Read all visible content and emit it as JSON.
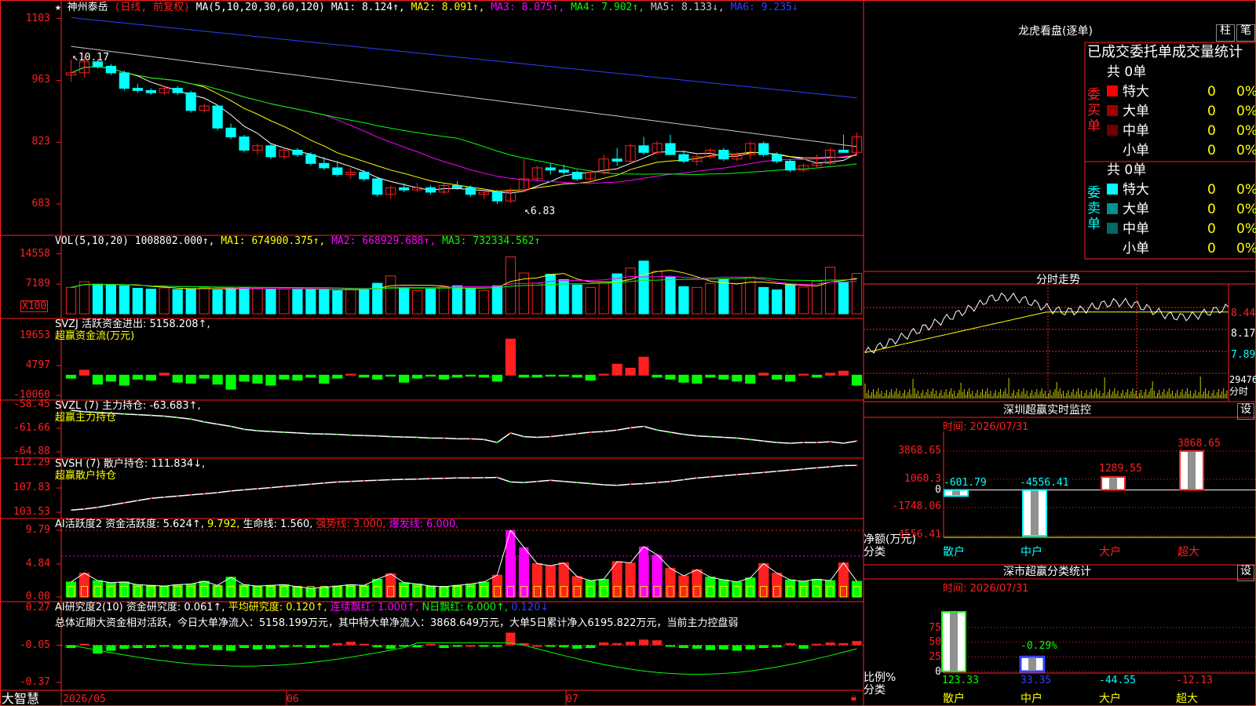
{
  "colors": {
    "up": "#ff2020",
    "down": "#00ffff",
    "bg": "#000000",
    "axis": "#ff2020",
    "yellow": "#ffff00",
    "white": "#ffffff",
    "magenta": "#ff00ff",
    "green": "#00ff00",
    "blue": "#3040ff",
    "orange": "#ff8000"
  },
  "stock": {
    "star": "★",
    "name": "神州泰岳",
    "mode": "(日线, 前复权)",
    "ma_label": "MA(5,10,20,30,60,120)",
    "ma": [
      {
        "label": "MA1: 8.124↑,",
        "color": "#ffffff"
      },
      {
        "label": "MA2: 8.091↑,",
        "color": "#ffff00"
      },
      {
        "label": "MA3: 8.075↑,",
        "color": "#ff00ff"
      },
      {
        "label": "MA4: 7.902↑,",
        "color": "#00ff00"
      },
      {
        "label": "MA5: 8.133↓,",
        "color": "#c8c8c8"
      },
      {
        "label": "MA6: 9.235↓",
        "color": "#3040ff"
      }
    ]
  },
  "price_axis": [
    "1103",
    "963",
    "823",
    "683"
  ],
  "price_high_label": "10.17",
  "price_low_label": "6.83",
  "vol": {
    "prefix": "VOL(5,10,20)",
    "value": "1008802.000↑,",
    "items": [
      {
        "label": "MA1: 674900.375↑,",
        "color": "#ffff00"
      },
      {
        "label": "MA2: 668929.688↑,",
        "color": "#ff00ff"
      },
      {
        "label": "MA3: 732334.562↑",
        "color": "#00ff00"
      }
    ],
    "axis": [
      "14558",
      "7189"
    ],
    "unit": "X100"
  },
  "svzj": {
    "title": "SVZJ  活跃资金进出: 5158.208↑,",
    "subtitle": "超赢资金流(万元)",
    "axis": [
      "19653",
      "4797",
      "-10060"
    ]
  },
  "svzl": {
    "title": "SVZL (7) 主力持仓: -63.683↑,",
    "subtitle": "超赢主力持仓",
    "axis": [
      "-58.45",
      "-61.66",
      "-64.88"
    ]
  },
  "svsh": {
    "title": "SVSH (7) 散户持仓: 111.834↓,",
    "subtitle": "超赢散户持仓",
    "axis": [
      "112.29",
      "107.83",
      "103.53"
    ]
  },
  "ai_act": {
    "title": "AI活跃度2 资金活跃度: 5.624↑,",
    "v2": "9.792,",
    "v3": "生命线: 1.560,",
    "v4": "强势线: 3.000,",
    "v5": "爆发线: 6.000,",
    "axis": [
      "9.79",
      "4.84",
      "0.00"
    ]
  },
  "ai_res": {
    "p1": "AI研究度2(10) 资金研究度: 0.061↑,",
    "p2": "平均研究度: 0.120↑,",
    "p3": "连续飘红: 1.000↑,",
    "p4": "N日飘红: 6.000↑,",
    "p5": "0.120↓",
    "desc": "总体近期大资金相对活跃，今日大单净流入：5158.199万元，其中特大单净流入：3868.649万元，大单5日累计净入6195.822万元，当前主力控盘弱",
    "axis": [
      "0.27",
      "-0.05",
      "-0.37"
    ]
  },
  "dates": [
    "2026/05",
    "06",
    "07"
  ],
  "brand": "大智慧",
  "panel": {
    "title": "龙虎看盘(逐单)",
    "tab1": "柱",
    "tab2": "笔",
    "headers": [
      "已成交",
      "委托单",
      "成交量统计"
    ],
    "buy": {
      "label": "委买单",
      "total": "共 0单",
      "rows": [
        {
          "name": "特大",
          "v1": "0",
          "v2": "0%",
          "color": "#ff0000"
        },
        {
          "name": "大单",
          "v1": "0",
          "v2": "0%",
          "color": "#a00000"
        },
        {
          "name": "中单",
          "v1": "0",
          "v2": "0%",
          "color": "#700000"
        },
        {
          "name": "小单",
          "v1": "0",
          "v2": "0%",
          "color": ""
        }
      ]
    },
    "sell": {
      "label": "委卖单",
      "total": "共 0单",
      "rows": [
        {
          "name": "特大",
          "v1": "0",
          "v2": "0%",
          "color": "#00ffff"
        },
        {
          "name": "大单",
          "v1": "0",
          "v2": "0%",
          "color": "#009090"
        },
        {
          "name": "中单",
          "v1": "0",
          "v2": "0%",
          "color": "#006868"
        },
        {
          "name": "小单",
          "v1": "0",
          "v2": "0%",
          "color": ""
        }
      ]
    }
  },
  "minute": {
    "title": "分时走势",
    "axis": [
      "8.44",
      "8.17",
      "7.89",
      "29476",
      "分时"
    ]
  },
  "monitor": {
    "title": "深圳超赢实时监控",
    "set": "设",
    "time": "时间: 2026/07/31",
    "axis": [
      "3868.65",
      "1060.3",
      "0",
      "-1748.06",
      "-4556.41"
    ],
    "ylabel": "净额(万元)",
    "xlabel": "分类",
    "labels": [
      "-601.79",
      "-4556.41",
      "1289.55",
      "3868.65"
    ],
    "cats": [
      "散户",
      "中户",
      "大户",
      "超大"
    ]
  },
  "classify": {
    "title": "深市超赢分类统计",
    "set": "设",
    "time": "时间: 2026/07/31",
    "axis": [
      "75",
      "50",
      "25",
      "0"
    ],
    "ylabel": "比例%",
    "xlabel": "分类",
    "bar_label": "-0.29%",
    "vals": [
      "123.33",
      "33.35",
      "-44.55",
      "-12.13"
    ],
    "cats": [
      "散户",
      "中户",
      "大户",
      "超大"
    ]
  },
  "chart_data": [
    {
      "type": "candlestick",
      "title": "神州泰岳 (日线, 前复权)",
      "period": "2026/05 - 2026/07",
      "ohlc": [
        [
          9.75,
          10.1,
          9.6,
          9.8
        ],
        [
          9.8,
          10.17,
          9.7,
          10.05
        ],
        [
          10.05,
          10.1,
          9.9,
          9.95
        ],
        [
          9.95,
          10.0,
          9.75,
          9.8
        ],
        [
          9.8,
          9.85,
          9.4,
          9.45
        ],
        [
          9.45,
          9.55,
          9.35,
          9.4
        ],
        [
          9.4,
          9.45,
          9.3,
          9.35
        ],
        [
          9.35,
          9.5,
          9.3,
          9.45
        ],
        [
          9.45,
          9.5,
          9.3,
          9.35
        ],
        [
          9.35,
          9.4,
          8.9,
          8.95
        ],
        [
          8.95,
          9.1,
          8.9,
          9.05
        ],
        [
          9.05,
          9.08,
          8.5,
          8.55
        ],
        [
          8.55,
          8.65,
          8.3,
          8.35
        ],
        [
          8.35,
          8.4,
          8.0,
          8.05
        ],
        [
          8.05,
          8.2,
          7.95,
          8.15
        ],
        [
          8.15,
          8.2,
          7.85,
          7.9
        ],
        [
          7.9,
          8.1,
          7.85,
          8.05
        ],
        [
          8.05,
          8.1,
          7.9,
          7.95
        ],
        [
          7.95,
          8.0,
          7.7,
          7.75
        ],
        [
          7.75,
          7.9,
          7.6,
          7.65
        ],
        [
          7.65,
          7.8,
          7.45,
          7.5
        ],
        [
          7.5,
          7.65,
          7.4,
          7.55
        ],
        [
          7.55,
          7.6,
          7.35,
          7.4
        ],
        [
          7.4,
          7.45,
          7.0,
          7.05
        ],
        [
          7.05,
          7.25,
          6.95,
          7.2
        ],
        [
          7.2,
          7.3,
          7.1,
          7.15
        ],
        [
          7.15,
          7.3,
          7.1,
          7.2
        ],
        [
          7.2,
          7.25,
          7.05,
          7.1
        ],
        [
          7.1,
          7.3,
          7.05,
          7.25
        ],
        [
          7.25,
          7.35,
          7.15,
          7.2
        ],
        [
          7.2,
          7.25,
          7.0,
          7.05
        ],
        [
          7.05,
          7.15,
          6.95,
          7.1
        ],
        [
          7.1,
          7.15,
          6.83,
          6.9
        ],
        [
          6.9,
          7.2,
          6.85,
          7.15
        ],
        [
          7.15,
          7.85,
          7.1,
          7.4
        ],
        [
          7.4,
          7.7,
          7.35,
          7.65
        ],
        [
          7.65,
          7.75,
          7.5,
          7.6
        ],
        [
          7.6,
          7.72,
          7.5,
          7.55
        ],
        [
          7.55,
          7.6,
          7.35,
          7.4
        ],
        [
          7.4,
          7.6,
          7.35,
          7.55
        ],
        [
          7.55,
          7.95,
          7.5,
          7.85
        ],
        [
          7.85,
          8.1,
          7.7,
          7.8
        ],
        [
          7.8,
          8.2,
          7.75,
          8.15
        ],
        [
          8.15,
          8.35,
          7.95,
          8.0
        ],
        [
          8.0,
          8.25,
          7.95,
          8.2
        ],
        [
          8.2,
          8.4,
          8.0,
          7.95
        ],
        [
          7.95,
          8.05,
          7.75,
          7.8
        ],
        [
          7.8,
          7.95,
          7.7,
          7.9
        ],
        [
          7.9,
          8.1,
          7.85,
          8.05
        ],
        [
          8.05,
          8.1,
          7.8,
          7.85
        ],
        [
          7.85,
          8.0,
          7.8,
          7.95
        ],
        [
          7.95,
          8.25,
          7.85,
          8.2
        ],
        [
          8.2,
          8.25,
          7.9,
          7.95
        ],
        [
          7.95,
          8.0,
          7.75,
          7.8
        ],
        [
          7.8,
          7.85,
          7.55,
          7.6
        ],
        [
          7.6,
          7.75,
          7.55,
          7.7
        ],
        [
          7.7,
          7.95,
          7.65,
          7.75
        ],
        [
          7.75,
          8.1,
          7.7,
          8.05
        ],
        [
          8.05,
          8.4,
          8.0,
          8.0
        ],
        [
          8.0,
          8.45,
          7.95,
          8.35
        ]
      ],
      "ylim": [
        6.3,
        11.2
      ]
    },
    {
      "type": "bar",
      "name": "VOL",
      "values": [
        6400,
        7800,
        7200,
        7100,
        6800,
        6200,
        6000,
        6300,
        5900,
        6100,
        6400,
        5800,
        6100,
        6300,
        6200,
        5900,
        6000,
        6100,
        5900,
        5800,
        5600,
        5900,
        6000,
        7400,
        9200,
        6300,
        5600,
        6000,
        6500,
        6800,
        6100,
        5700,
        6800,
        13800,
        9900,
        7400,
        9600,
        8300,
        7000,
        6400,
        7400,
        9700,
        11100,
        12800,
        10300,
        8900,
        6600,
        6400,
        7400,
        8400,
        7400,
        8900,
        6400,
        5800,
        7100,
        6500,
        7900,
        11300,
        7600,
        9800
      ],
      "ylim": [
        0,
        16000
      ]
    },
    {
      "type": "bar",
      "name": "SVZJ",
      "values": [
        -1500,
        2500,
        -4500,
        -3000,
        -5000,
        -2000,
        -2500,
        1000,
        -3500,
        -4000,
        -1500,
        -4500,
        -7000,
        -3000,
        -4000,
        -5000,
        -2000,
        -2500,
        -1000,
        -4000,
        -1500,
        500,
        -1000,
        -2000,
        -500,
        -3500,
        -1500,
        -500,
        -2000,
        -1000,
        -500,
        -1000,
        -3000,
        18000,
        -1000,
        -1000,
        -500,
        -500,
        -1000,
        -2500,
        500,
        5500,
        3500,
        9000,
        -1000,
        -2000,
        -3500,
        -4000,
        -1000,
        -2000,
        -3000,
        -4000,
        1000,
        -2000,
        -3000,
        500,
        -1000,
        1000,
        2000,
        -5000,
        4000
      ],
      "ylim": [
        -10060,
        19653
      ]
    },
    {
      "type": "line",
      "name": "SVZL",
      "values": [
        -59.2,
        -59.4,
        -59.5,
        -59.6,
        -59.7,
        -59.8,
        -59.9,
        -60.0,
        -60.2,
        -60.4,
        -60.8,
        -61.1,
        -61.4,
        -61.8,
        -62.0,
        -62.1,
        -62.2,
        -62.3,
        -62.4,
        -62.45,
        -62.5,
        -62.6,
        -62.65,
        -62.7,
        -62.8,
        -62.85,
        -62.9,
        -63.0,
        -63.0,
        -63.1,
        -63.1,
        -63.2,
        -63.6,
        -62.3,
        -62.8,
        -62.9,
        -62.8,
        -62.6,
        -62.4,
        -62.2,
        -62.1,
        -61.9,
        -61.6,
        -61.4,
        -61.9,
        -62.2,
        -62.5,
        -62.7,
        -62.8,
        -62.9,
        -63.0,
        -63.2,
        -63.4,
        -63.6,
        -63.7,
        -63.6,
        -63.6,
        -63.5,
        -63.7,
        -63.4
      ],
      "ylim": [
        -64.88,
        -58.45
      ]
    },
    {
      "type": "line",
      "name": "SVSH",
      "values": [
        103.9,
        104.1,
        104.4,
        104.8,
        105.2,
        105.6,
        106.0,
        106.2,
        106.4,
        106.6,
        106.8,
        107.0,
        107.3,
        107.5,
        107.7,
        107.9,
        108.1,
        108.3,
        108.5,
        108.7,
        108.9,
        109.0,
        109.1,
        109.2,
        109.3,
        109.35,
        109.4,
        109.5,
        109.55,
        109.6,
        109.6,
        109.65,
        109.7,
        108.9,
        108.8,
        109.0,
        109.2,
        109.0,
        108.8,
        108.6,
        108.4,
        108.3,
        108.5,
        108.6,
        108.8,
        109.0,
        109.3,
        109.6,
        109.8,
        110.0,
        110.2,
        110.4,
        110.6,
        110.8,
        111.0,
        111.2,
        111.4,
        111.6,
        111.8,
        111.834
      ],
      "ylim": [
        103.53,
        112.29
      ]
    },
    {
      "type": "bar",
      "name": "AI活跃度2",
      "values": [
        2.2,
        3.5,
        2.4,
        2.1,
        2.2,
        1.8,
        1.7,
        1.6,
        1.8,
        1.9,
        2.3,
        1.7,
        2.9,
        1.8,
        1.6,
        1.7,
        1.8,
        1.5,
        1.3,
        1.4,
        1.6,
        1.8,
        1.7,
        2.6,
        3.4,
        2.1,
        1.9,
        1.6,
        1.5,
        1.7,
        1.9,
        2.2,
        3.2,
        9.792,
        7.3,
        4.9,
        4.6,
        5.0,
        3.0,
        2.4,
        2.6,
        5.2,
        5.0,
        7.4,
        6.2,
        4.2,
        3.1,
        4.0,
        2.9,
        2.5,
        2.2,
        2.8,
        4.9,
        3.5,
        2.5,
        2.3,
        2.6,
        2.4,
        5.0,
        2.3,
        5.624
      ],
      "ylim": [
        0,
        9.79
      ]
    },
    {
      "type": "bar",
      "name": "AI研究度2",
      "values": [
        -0.04,
        0.02,
        -0.12,
        -0.08,
        -0.05,
        -0.04,
        -0.04,
        -0.02,
        -0.05,
        -0.06,
        -0.03,
        -0.07,
        -0.08,
        -0.04,
        -0.06,
        -0.05,
        -0.03,
        -0.02,
        -0.04,
        -0.03,
        0.03,
        0.05,
        0.02,
        -0.03,
        -0.05,
        -0.02,
        -0.03,
        0.02,
        -0.04,
        -0.01,
        0.0,
        -0.02,
        -0.01,
        0.18,
        0.03,
        0.0,
        -0.02,
        -0.03,
        -0.05,
        -0.04,
        0.04,
        0.03,
        0.05,
        0.08,
        0.07,
        -0.01,
        -0.04,
        -0.05,
        -0.07,
        -0.06,
        -0.08,
        -0.06,
        -0.04,
        -0.03,
        0.03,
        -0.05,
        0.02,
        0.04,
        0.03,
        0.06,
        -0.08,
        0.05
      ],
      "ylim": [
        -0.37,
        0.27
      ]
    },
    {
      "type": "bar",
      "name": "深圳超赢实时监控",
      "categories": [
        "散户",
        "中户",
        "大户",
        "超大"
      ],
      "values": [
        -601.79,
        -4556.41,
        1289.55,
        3868.65
      ],
      "ylim": [
        -4556.41,
        3868.65
      ]
    },
    {
      "type": "bar",
      "name": "深市超赢分类统计",
      "categories": [
        "散户",
        "中户",
        "大户",
        "超大"
      ],
      "values": [
        123.33,
        33.35,
        -44.55,
        -12.13
      ],
      "ylim": [
        0,
        75
      ]
    }
  ]
}
